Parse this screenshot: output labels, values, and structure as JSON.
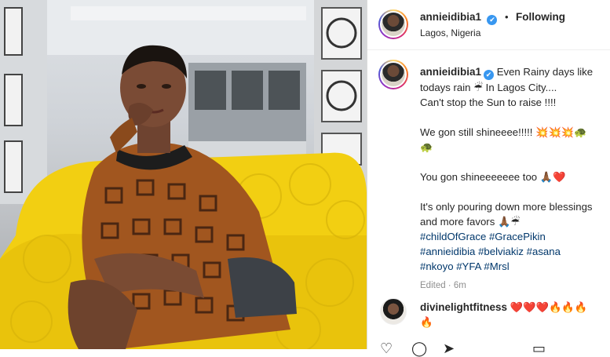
{
  "post": {
    "username": "annieidibia1",
    "verified_mark": "✔",
    "follow_status": "Following",
    "separator": "•",
    "location": "Lagos, Nigeria"
  },
  "caption": {
    "line1_text": "Even Rainy days like todays rain ☔ In Lagos City....",
    "line2": "Can't stop the Sun to raise !!!!",
    "line3": "We gon still shineeee!!!!! 💥💥💥🐢",
    "line3b": "🐢",
    "line4": "You gon shineeeeeee too 🙏🏾❤️",
    "line5": "It's only pouring down more blessings and more favors 🙏🏾☔",
    "hashtags": [
      "#childOfGrace",
      "#GracePikin",
      "#annieidibia",
      "#belviakiz",
      "#asana",
      "#nkoyo",
      "#YFA",
      "#Mrsl"
    ],
    "edited": "Edited · 6m"
  },
  "comment": {
    "username": "divinelightfitness",
    "text": "❤️❤️❤️🔥🔥🔥",
    "text_line2": "🔥"
  },
  "icons": {
    "heart": "heart-icon",
    "comment": "comment-icon",
    "share": "share-icon",
    "save": "bookmark-icon"
  },
  "colors": {
    "link": "#00376b",
    "verified": "#3897f0",
    "sofa": "#f4d21a",
    "muted": "#8e8e8e"
  }
}
